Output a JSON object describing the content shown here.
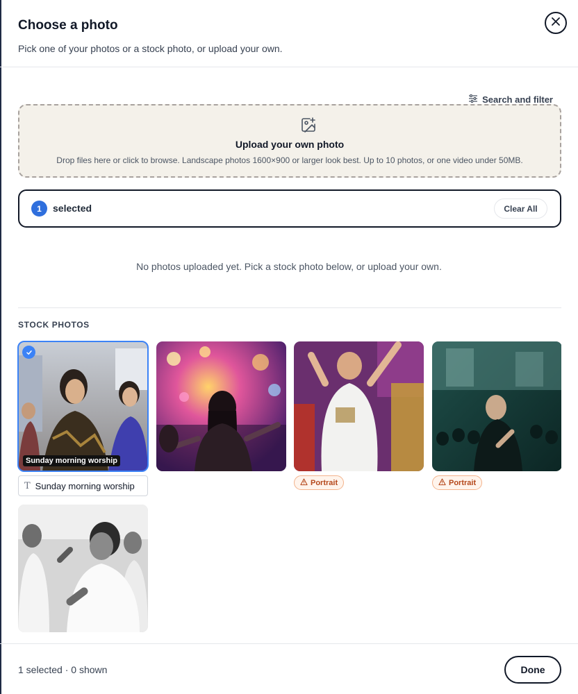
{
  "modal": {
    "title": "Choose a photo",
    "subtitle": "Pick one of your photos or a stock photo, or upload your own.",
    "close_icon": "close-icon"
  },
  "toolbar": {
    "search_filter_label": "Search and filter",
    "search_filter_icon": "sliders-icon"
  },
  "upload": {
    "icon": "image-plus-icon",
    "title": "Upload your own photo",
    "description": "Drop files here or click to browse. Landscape photos 1600×900 or larger look best. Up to 10 photos, or one video under 50MB."
  },
  "selection": {
    "count": "1",
    "label": "selected",
    "clear_label": "Clear All"
  },
  "my_photos": {
    "empty_message": "No photos uploaded yet. Pick a stock photo below, or upload your own."
  },
  "stock": {
    "section_label": "STOCK PHOTOS",
    "photos": [
      {
        "selected": true,
        "caption_overlay": "Sunday morning worship",
        "caption_value": "Sunday morning worship",
        "badge": ""
      },
      {
        "selected": false,
        "caption_overlay": "",
        "badge": ""
      },
      {
        "selected": false,
        "caption_overlay": "",
        "badge": "Portrait"
      },
      {
        "selected": false,
        "caption_overlay": "",
        "badge": "Portrait"
      },
      {
        "selected": false,
        "caption_overlay": "",
        "badge": ""
      }
    ]
  },
  "footer": {
    "status": "1 selected · 0 shown",
    "done_label": "Done"
  },
  "colors": {
    "accent": "#2f6fdd",
    "upload_bg": "#f4f1ea",
    "portrait_badge_text": "#b4471a"
  }
}
